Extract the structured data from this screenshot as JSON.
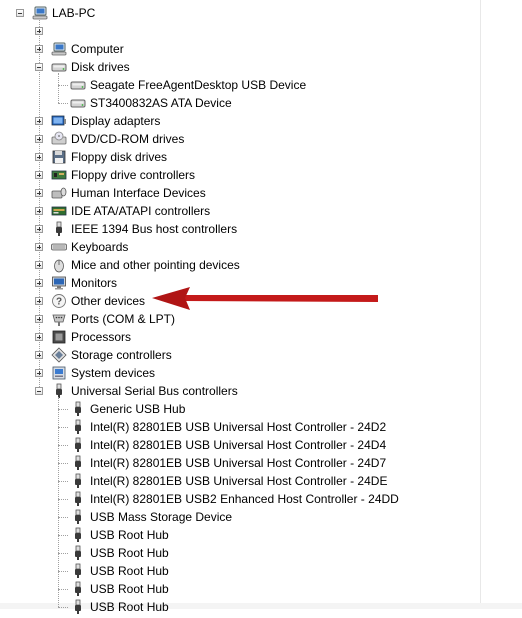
{
  "root": {
    "label": "LAB-PC",
    "icon": "computer-icon"
  },
  "categories": [
    {
      "id": "computer",
      "label": "Computer",
      "icon": "computer-icon",
      "expanded": false
    },
    {
      "id": "disk-drives",
      "label": "Disk drives",
      "icon": "disk-drive-icon",
      "expanded": true,
      "children": [
        {
          "label": "Seagate FreeAgentDesktop USB Device",
          "icon": "disk-drive-icon"
        },
        {
          "label": "ST3400832AS ATA Device",
          "icon": "disk-drive-icon"
        }
      ]
    },
    {
      "id": "display-adapters",
      "label": "Display adapters",
      "icon": "display-adapter-icon",
      "expanded": false
    },
    {
      "id": "dvd-cdrom",
      "label": "DVD/CD-ROM drives",
      "icon": "dvd-drive-icon",
      "expanded": false
    },
    {
      "id": "floppy-disk",
      "label": "Floppy disk drives",
      "icon": "floppy-disk-icon",
      "expanded": false
    },
    {
      "id": "floppy-controllers",
      "label": "Floppy drive controllers",
      "icon": "controller-icon",
      "expanded": false
    },
    {
      "id": "hid",
      "label": "Human Interface Devices",
      "icon": "hid-icon",
      "expanded": false
    },
    {
      "id": "ide",
      "label": "IDE ATA/ATAPI controllers",
      "icon": "ide-controller-icon",
      "expanded": false
    },
    {
      "id": "ieee1394",
      "label": "IEEE 1394 Bus host controllers",
      "icon": "firewire-icon",
      "expanded": false
    },
    {
      "id": "keyboards",
      "label": "Keyboards",
      "icon": "keyboard-icon",
      "expanded": false
    },
    {
      "id": "mice",
      "label": "Mice and other pointing devices",
      "icon": "mouse-icon",
      "expanded": false
    },
    {
      "id": "monitors",
      "label": "Monitors",
      "icon": "monitor-icon",
      "expanded": false
    },
    {
      "id": "other-devices",
      "label": "Other devices",
      "icon": "unknown-device-icon",
      "expanded": false
    },
    {
      "id": "ports",
      "label": "Ports (COM & LPT)",
      "icon": "port-icon",
      "expanded": false
    },
    {
      "id": "processors",
      "label": "Processors",
      "icon": "processor-icon",
      "expanded": false
    },
    {
      "id": "storage",
      "label": "Storage controllers",
      "icon": "storage-controller-icon",
      "expanded": false
    },
    {
      "id": "system",
      "label": "System devices",
      "icon": "system-device-icon",
      "expanded": false
    },
    {
      "id": "usb",
      "label": "Universal Serial Bus controllers",
      "icon": "usb-icon",
      "expanded": true,
      "children": [
        {
          "label": "Generic USB Hub",
          "icon": "usb-icon"
        },
        {
          "label": "Intel(R) 82801EB USB Universal Host Controller - 24D2",
          "icon": "usb-icon"
        },
        {
          "label": "Intel(R) 82801EB USB Universal Host Controller - 24D4",
          "icon": "usb-icon"
        },
        {
          "label": "Intel(R) 82801EB USB Universal Host Controller - 24D7",
          "icon": "usb-icon"
        },
        {
          "label": "Intel(R) 82801EB USB Universal Host Controller - 24DE",
          "icon": "usb-icon"
        },
        {
          "label": "Intel(R) 82801EB USB2 Enhanced Host Controller - 24DD",
          "icon": "usb-icon"
        },
        {
          "label": "USB Mass Storage Device",
          "icon": "usb-icon"
        },
        {
          "label": "USB Root Hub",
          "icon": "usb-icon"
        },
        {
          "label": "USB Root Hub",
          "icon": "usb-icon"
        },
        {
          "label": "USB Root Hub",
          "icon": "usb-icon"
        },
        {
          "label": "USB Root Hub",
          "icon": "usb-icon"
        },
        {
          "label": "USB Root Hub",
          "icon": "usb-icon"
        }
      ]
    }
  ],
  "annotation": {
    "target": "other-devices",
    "arrow_color": "#c41a1a"
  },
  "colors": {
    "text": "#000000",
    "tree_line": "#a0a0a0",
    "arrow": "#c41a1a"
  }
}
